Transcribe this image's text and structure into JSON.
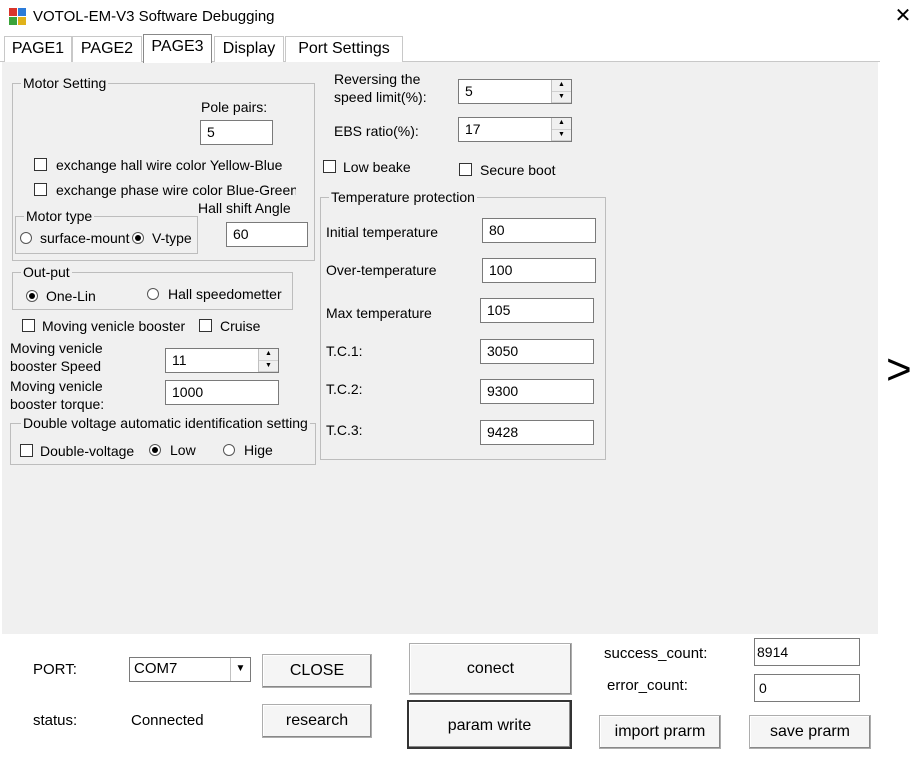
{
  "window": {
    "title": "VOTOL-EM-V3 Software Debugging"
  },
  "tabs": [
    {
      "label": "PAGE1"
    },
    {
      "label": "PAGE2"
    },
    {
      "label": "PAGE3",
      "active": true
    },
    {
      "label": "Display"
    },
    {
      "label": "Port Settings"
    }
  ],
  "motor_setting": {
    "title": "Motor Setting",
    "pole_pairs_label": "Pole pairs:",
    "pole_pairs_value": "5",
    "exchange_hall_label": "exchange hall wire color Yellow-Blue",
    "exchange_phase_label": "exchange phase wire color Blue-Green",
    "hall_shift_label": "Hall shift Angle",
    "hall_shift_value": "60",
    "motor_type": {
      "title": "Motor type",
      "surface_label": "surface-mounted",
      "vtype_label": "V-type"
    }
  },
  "output": {
    "title": "Out-put",
    "one_line_label": "One-Lin",
    "hall_speedometer_label": "Hall speedometter"
  },
  "moving_booster_label": "Moving venicle booster",
  "cruise_label": "Cruise",
  "booster_speed_label_1": "Moving venicle",
  "booster_speed_label_2": "booster Speed",
  "booster_speed_value": "11",
  "booster_torque_label_1": "Moving venicle",
  "booster_torque_label_2": "booster torque:",
  "booster_torque_value": "1000",
  "double_voltage": {
    "title": "Double voltage automatic identification setting",
    "double_label": "Double-voltage",
    "low_label": "Low",
    "high_label": "Hige"
  },
  "reversing_label_1": "Reversing the",
  "reversing_label_2": "speed limit(%):",
  "reversing_value": "5",
  "ebs_label": "EBS ratio(%):",
  "ebs_value": "17",
  "low_brake_label": "Low beake",
  "secure_boot_label": "Secure boot",
  "temperature": {
    "title": "Temperature protection",
    "rows": [
      {
        "label": "Initial temperature",
        "value": "80"
      },
      {
        "label": "Over-temperature",
        "value": "100"
      },
      {
        "label": "Max temperature",
        "value": "105"
      },
      {
        "label": "T.C.1:",
        "value": "3050"
      },
      {
        "label": "T.C.2:",
        "value": "9300"
      },
      {
        "label": "T.C.3:",
        "value": "9428"
      }
    ]
  },
  "next_arrow": ">",
  "bottom": {
    "port_label": "PORT:",
    "port_value": "COM7",
    "close_button": "CLOSE",
    "status_label": "status:",
    "status_value": "Connected",
    "research_button": "research",
    "connect_button": "conect",
    "param_write_button": "param write",
    "success_label": "success_count:",
    "success_value": "8914",
    "error_label": "error_count:",
    "error_value": "0",
    "import_button": "import prarm",
    "save_button": "save prarm"
  }
}
